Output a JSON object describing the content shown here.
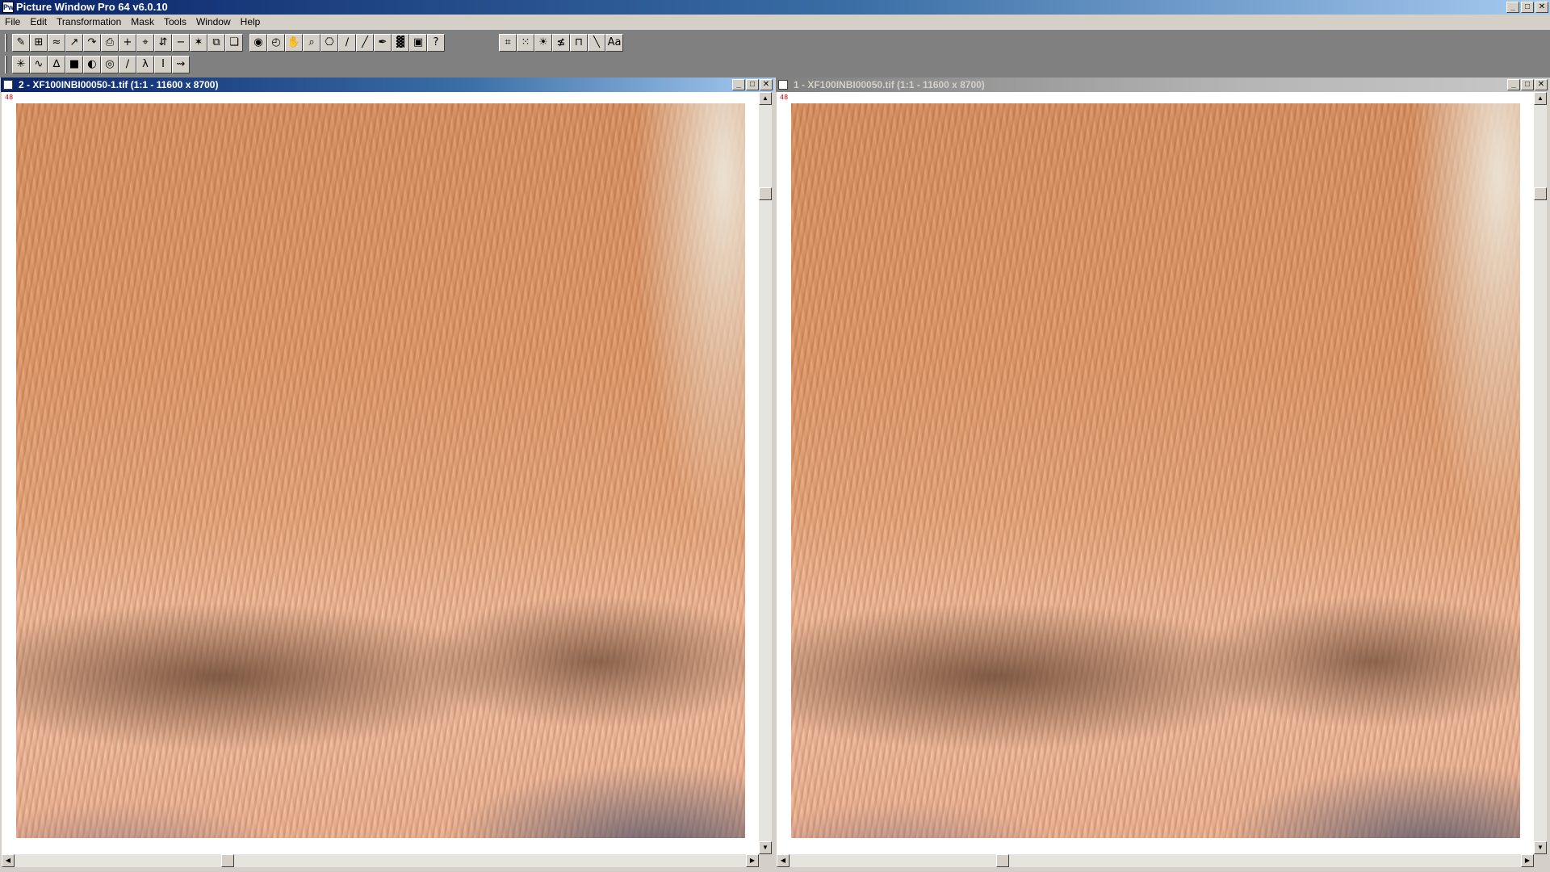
{
  "app": {
    "title": "Picture Window Pro 64  v6.0.10",
    "icon_label": "Pw",
    "window_buttons": [
      "_",
      "□",
      "✕"
    ]
  },
  "menubar": [
    "File",
    "Edit",
    "Transformation",
    "Mask",
    "Tools",
    "Window",
    "Help"
  ],
  "toolbar1": {
    "group1": [
      "✎",
      "⊞",
      "≈",
      "↗",
      "↷",
      "⎙",
      "+",
      "⌖",
      "⇵",
      "−",
      "✶",
      "⧉",
      "❏"
    ],
    "group2": [
      "◉",
      "◴",
      "✋",
      "⌕",
      "⎔",
      "∕",
      "╱",
      "✒",
      "▓",
      "▣",
      "?"
    ],
    "group3": [
      "⌗",
      "⁙",
      "☀",
      "≰",
      "⊓",
      "╲",
      "Aa"
    ]
  },
  "toolbar2": [
    "✳",
    "∿",
    "∆",
    "■",
    "◐",
    "◎",
    "∕",
    "λ",
    "I",
    "⇝"
  ],
  "windows": [
    {
      "title": "2 - XF100INBI00050-1.tif (1:1 - 11600 x 8700)",
      "state": "active",
      "corner_label": "48",
      "buttons": [
        "_",
        "□",
        "✕"
      ]
    },
    {
      "title": "1 - XF100INBI00050.tif (1:1 - 11600 x 8700)",
      "state": "inactive",
      "corner_label": "48",
      "buttons": [
        "_",
        "□",
        "✕"
      ]
    }
  ],
  "scroll_arrows": {
    "up": "▲",
    "down": "▼",
    "left": "◀",
    "right": "▶"
  },
  "colors": {
    "active_title": "#0a246a",
    "inactive_title": "#808080",
    "face": "#d4d0c8",
    "workspace": "#808080"
  }
}
